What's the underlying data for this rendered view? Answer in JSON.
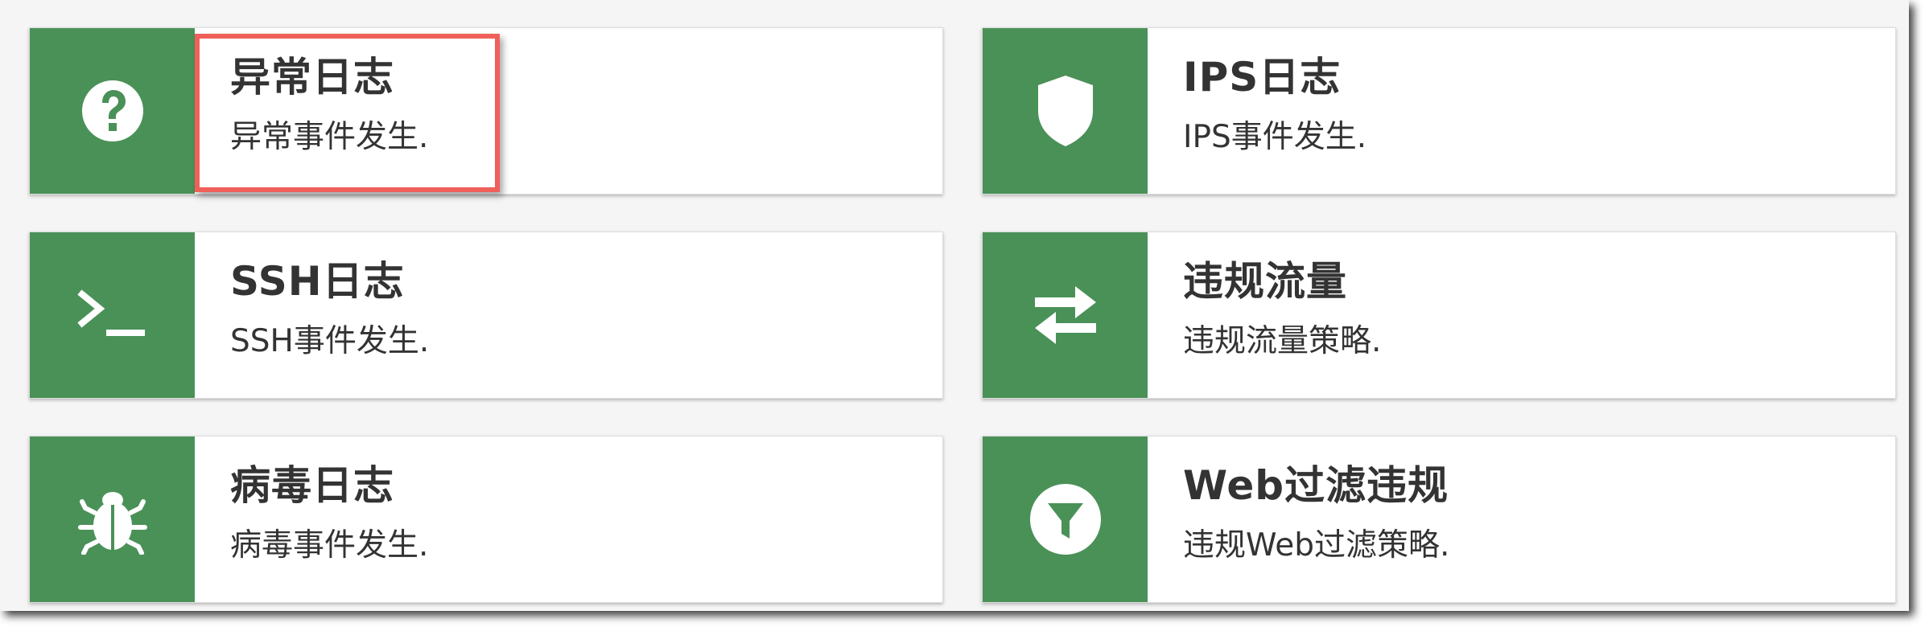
{
  "cards": [
    {
      "title": "异常日志",
      "desc": "异常事件发生.",
      "icon": "question-icon"
    },
    {
      "title": "IPS日志",
      "desc": "IPS事件发生.",
      "icon": "shield-icon"
    },
    {
      "title": "SSH日志",
      "desc": "SSH事件发生.",
      "icon": "terminal-icon"
    },
    {
      "title": "违规流量",
      "desc": "违规流量策略.",
      "icon": "exchange-arrows-icon"
    },
    {
      "title": "病毒日志",
      "desc": "病毒事件发生.",
      "icon": "bug-icon"
    },
    {
      "title": "Web过滤违规",
      "desc": "违规Web过滤策略.",
      "icon": "filter-icon"
    }
  ],
  "highlighted_card": "异常日志",
  "colors": {
    "accent_green": "#4a9158",
    "highlight_red": "#f0605a",
    "text": "#333333",
    "card_bg": "#ffffff",
    "page_bg": "#f5f5f5"
  }
}
